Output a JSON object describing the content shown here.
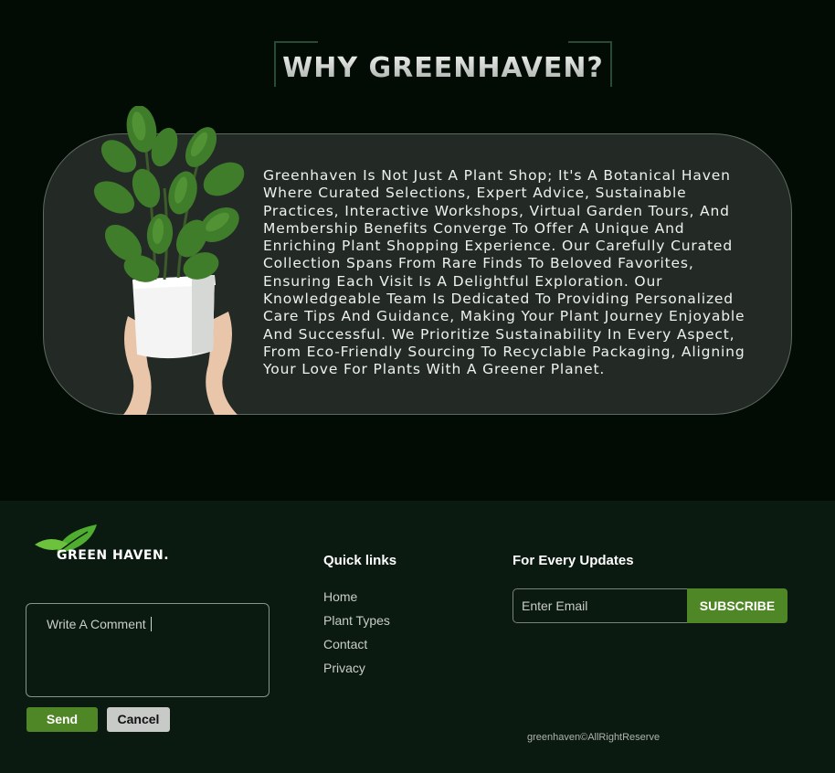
{
  "section": {
    "heading": "WHY GREENHAVEN?",
    "description": "Greenhaven Is Not Just A Plant Shop; It's A Botanical Haven Where Curated Selections, Expert Advice, Sustainable Practices, Interactive Workshops, Virtual Garden Tours, And Membership Benefits Converge To Offer A Unique And Enriching Plant Shopping Experience. Our Carefully Curated Collection Spans From Rare Finds To Beloved Favorites, Ensuring Each Visit Is A Delightful Exploration. Our Knowledgeable Team Is Dedicated To Providing Personalized Care Tips And Guidance, Making Your Plant Journey Enjoyable And Successful. We Prioritize Sustainability In Every Aspect, From Eco-Friendly Sourcing To Recyclable Packaging, Aligning Your Love For Plants With A Greener Planet."
  },
  "footer": {
    "logo_text": "GREEN HAVEN.",
    "comment_placeholder": "Write A Comment",
    "send_label": "Send",
    "cancel_label": "Cancel",
    "quick_links_title": "Quick links",
    "quick_links": [
      {
        "label": "Home"
      },
      {
        "label": "Plant Types"
      },
      {
        "label": "Contact"
      },
      {
        "label": "Privacy"
      }
    ],
    "updates_title": "For Every Updates",
    "email_placeholder": "Enter Email",
    "subscribe_label": "SUBSCRIBE",
    "copyright": "greenhaven©AllRightReserve"
  },
  "colors": {
    "background": "#020c05",
    "footer_bg": "#0b1a10",
    "card_bg": "#232a26",
    "accent": "#4f8626"
  },
  "icons": [
    "leaf-logo-icon",
    "plant-image"
  ]
}
